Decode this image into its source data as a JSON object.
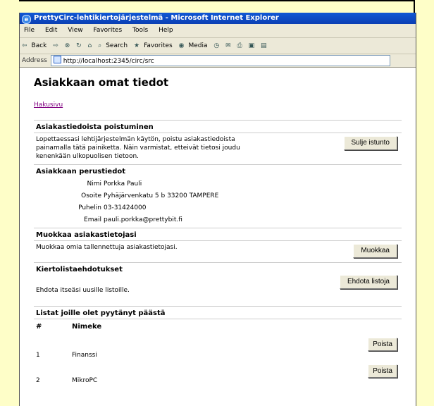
{
  "window": {
    "title": "PrettyCirc-lehtikiertojärjestelmä - Microsoft Internet Explorer"
  },
  "menu": [
    "File",
    "Edit",
    "View",
    "Favorites",
    "Tools",
    "Help"
  ],
  "toolbar": {
    "back": "Back",
    "search": "Search",
    "favorites": "Favorites",
    "media": "Media"
  },
  "address": {
    "label": "Address",
    "url": "http://localhost:2345/circ/src"
  },
  "page": {
    "title": "Asiakkaan omat tiedot",
    "search_link": "Hakusivu",
    "logout": {
      "heading": "Asiakastiedoista poistuminen",
      "text": "Lopettaessasi lehtijärjestelmän käytön, poistu asiakastiedoista painamalla tätä painiketta. Näin varmistat, etteivät tietosi joudu kenenkään ulkopuolisen tietoon.",
      "button": "Sulje istunto"
    },
    "basic": {
      "heading": "Asiakkaan perustiedot",
      "fields": [
        {
          "label": "Nimi",
          "value": "Porkka Pauli"
        },
        {
          "label": "Osoite",
          "value": "Pyhäjärvenkatu 5 b 33200 TAMPERE"
        },
        {
          "label": "Puhelin",
          "value": "03-31424000"
        },
        {
          "label": "Email",
          "value": "pauli.porkka@prettybit.fi"
        }
      ]
    },
    "edit": {
      "heading": "Muokkaa asiakastietojasi",
      "text": "Muokkaa omia tallennettuja asiakastietojasi.",
      "button": "Muokkaa"
    },
    "suggest": {
      "heading": "Kiertolistaehdotukset",
      "text": "Ehdota itseäsi uusille listoille.",
      "button": "Ehdota listoja"
    },
    "lists": {
      "heading": "Listat joille olet pyytänyt päästä",
      "col_num": "#",
      "col_name": "Nimeke",
      "rows": [
        {
          "num": "1",
          "name": "Finanssi",
          "button": "Poista"
        },
        {
          "num": "2",
          "name": "MikroPC",
          "button": "Poista"
        }
      ]
    }
  }
}
